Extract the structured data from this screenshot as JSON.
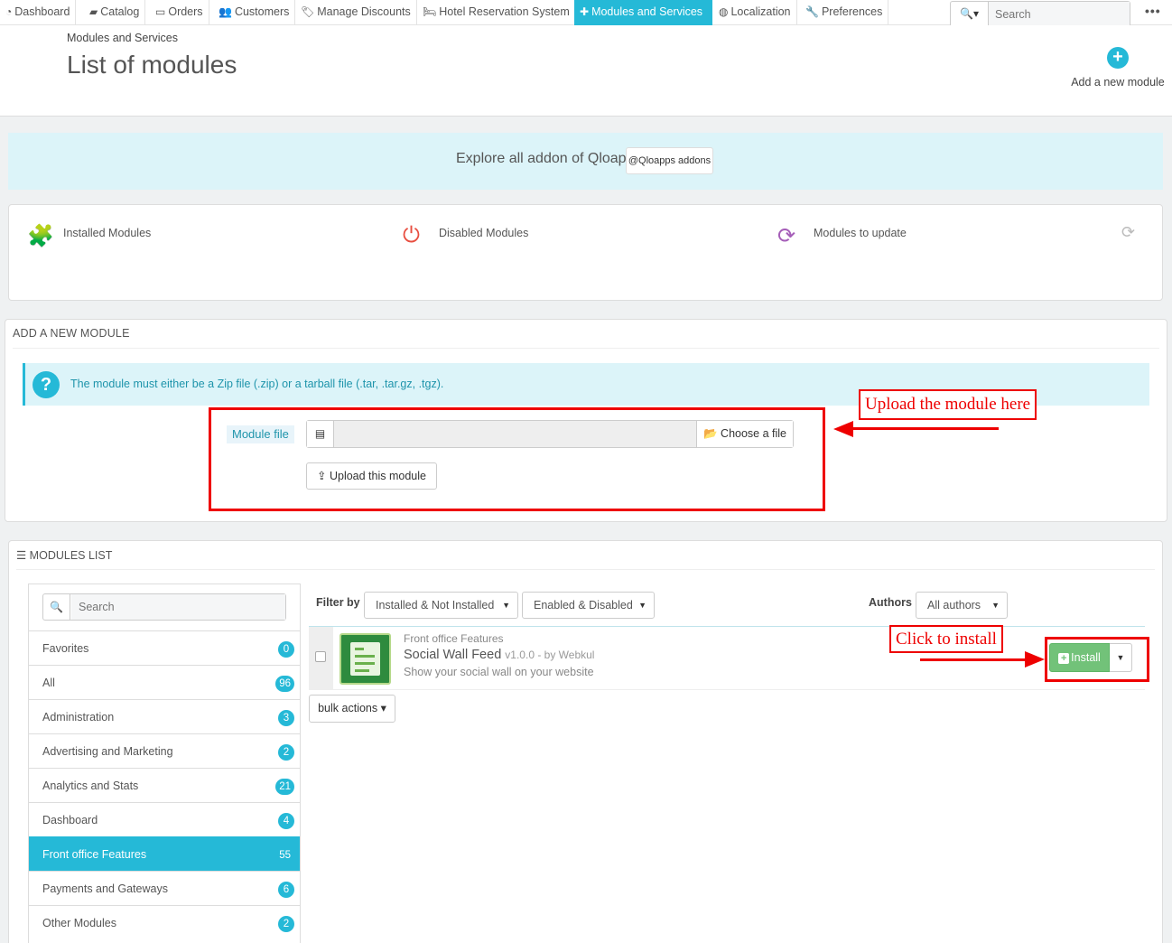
{
  "nav": {
    "items": [
      {
        "label": "Dashboard",
        "icon": "dashboard-icon",
        "glyph": "◔"
      },
      {
        "label": "Catalog",
        "icon": "book-icon",
        "glyph": "▰"
      },
      {
        "label": "Orders",
        "icon": "credit-card-icon",
        "glyph": "▭"
      },
      {
        "label": "Customers",
        "icon": "users-icon",
        "glyph": "👥"
      },
      {
        "label": "Manage Discounts",
        "icon": "tags-icon",
        "glyph": "🏷"
      },
      {
        "label": "Hotel Reservation System",
        "icon": "bed-icon",
        "glyph": "🛏"
      },
      {
        "label": "Modules and Services",
        "icon": "puzzle-icon",
        "glyph": "✚"
      },
      {
        "label": "Localization",
        "icon": "globe-icon",
        "glyph": "◍"
      },
      {
        "label": "Preferences",
        "icon": "wrench-icon",
        "glyph": "🔧"
      }
    ],
    "search_placeholder": "Search",
    "search_glyph": "🔍▾",
    "more_glyph": "•••"
  },
  "header": {
    "breadcrumb": "Modules and Services",
    "title": "List of modules",
    "add_module_label": "Add a new module",
    "add_module_glyph": "+"
  },
  "addons": {
    "text": "Explore all addon of Qloapps",
    "button": "@Qloapps addons"
  },
  "stats": {
    "installed": "Installed Modules",
    "disabled": "Disabled Modules",
    "to_update": "Modules to update",
    "installed_glyph": "🧩",
    "disabled_glyph": "⏻",
    "update_glyph": "⟳",
    "refresh_glyph": "⟳",
    "colors": {
      "installed": "#25b9d7",
      "disabled": "#e84e40",
      "update": "#a55eb8"
    }
  },
  "add_new": {
    "heading": "ADD A NEW MODULE",
    "info": "The module must either be a Zip file (.zip) or a tarball file (.tar, .tar.gz, .tgz).",
    "info_glyph": "?",
    "module_file_label": "Module file",
    "file_glyph": "▤",
    "choose_label": "📂 Choose a file",
    "upload_label": "⇪ Upload this module"
  },
  "annotations": {
    "upload_here": "Upload the module here",
    "click_install": "Click to install"
  },
  "list": {
    "heading": "☰ MODULES LIST",
    "search_placeholder": "Search",
    "search_glyph": "🔍",
    "categories": [
      {
        "label": "Favorites",
        "count": "0"
      },
      {
        "label": "All",
        "count": "96"
      },
      {
        "label": "Administration",
        "count": "3"
      },
      {
        "label": "Advertising and Marketing",
        "count": "2"
      },
      {
        "label": "Analytics and Stats",
        "count": "21"
      },
      {
        "label": "Dashboard",
        "count": "4"
      },
      {
        "label": "Front office Features",
        "count": "55"
      },
      {
        "label": "Payments and Gateways",
        "count": "6"
      },
      {
        "label": "Other Modules",
        "count": "2"
      }
    ],
    "active_category": "Front office Features",
    "filter_by": "Filter by",
    "filter_install": "Installed & Not Installed",
    "filter_enabled": "Enabled & Disabled",
    "authors_label": "Authors",
    "authors_value": "All authors",
    "caret_glyph": "▼",
    "module": {
      "category": "Front office Features",
      "name": "Social Wall Feed",
      "version": "v1.0.0 - by Webkul",
      "description": "Show your social wall on your website",
      "install_label": "Install",
      "install_glyph": "+"
    },
    "bulk_actions": "bulk actions ▾"
  }
}
